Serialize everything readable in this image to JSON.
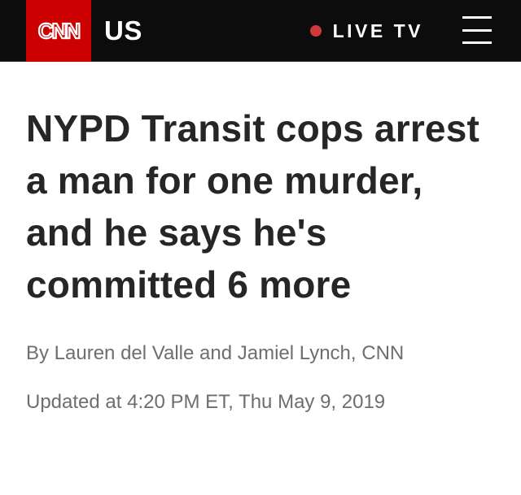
{
  "header": {
    "logo_text": "CNN",
    "section": "US",
    "live_label": "LIVE TV",
    "live_color": "#d0393a",
    "brand_color": "#cc0000",
    "menu_icon": "hamburger-menu-icon"
  },
  "article": {
    "headline": "NYPD Transit cops arrest a man for one murder, and he says he's committed 6 more",
    "byline": "By Lauren del Valle and Jamiel Lynch, CNN",
    "updated": "Updated at 4:20 PM ET, Thu May 9, 2019"
  }
}
